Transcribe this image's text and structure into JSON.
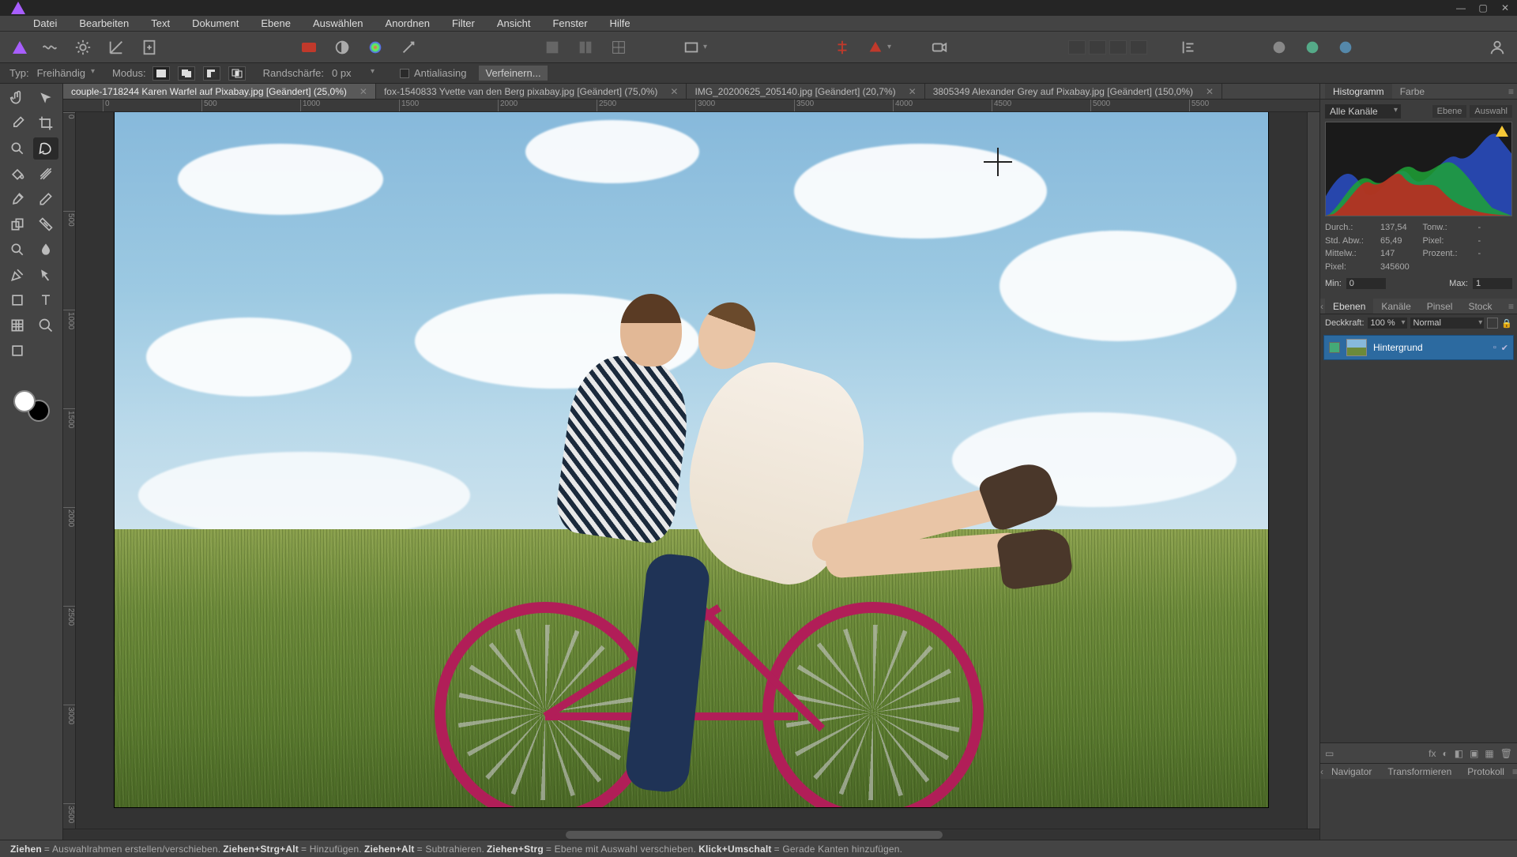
{
  "menus": [
    "Datei",
    "Bearbeiten",
    "Text",
    "Dokument",
    "Ebene",
    "Auswählen",
    "Anordnen",
    "Filter",
    "Ansicht",
    "Fenster",
    "Hilfe"
  ],
  "context": {
    "typ_label": "Typ:",
    "typ_value": "Freihändig",
    "modus_label": "Modus:",
    "feather_label": "Randschärfe:",
    "feather_value": "0 px",
    "antialias_label": "Antialiasing",
    "refine_label": "Verfeinern..."
  },
  "tabs": [
    {
      "title": "couple-1718244 Karen Warfel auf Pixabay.jpg [Geändert] (25,0%)",
      "active": true
    },
    {
      "title": "fox-1540833 Yvette van den Berg pixabay.jpg [Geändert] (75,0%)",
      "active": false
    },
    {
      "title": "IMG_20200625_205140.jpg [Geändert] (20,7%)",
      "active": false
    },
    {
      "title": "3805349 Alexander Grey auf Pixabay.jpg [Geändert] (150,0%)",
      "active": false
    }
  ],
  "ruler_h": [
    "0",
    "500",
    "1000",
    "1500",
    "2000",
    "2500",
    "3000",
    "3500",
    "4000",
    "4500",
    "5000",
    "5500"
  ],
  "ruler_v": [
    "0",
    "500",
    "1000",
    "1500",
    "2000",
    "2500",
    "3000",
    "3500"
  ],
  "hist_panel": {
    "tabs": [
      "Histogramm",
      "Farbe"
    ],
    "channel_label": "Alle Kanäle",
    "btn_layer": "Ebene",
    "btn_sel": "Auswahl",
    "stats": {
      "durch_l": "Durch.:",
      "durch_v": "137,54",
      "abw_l": "Std. Abw.:",
      "abw_v": "65,49",
      "mittel_l": "Mittelw.:",
      "mittel_v": "147",
      "pixel_l": "Pixel:",
      "pixel_v": "345600",
      "tonw_l": "Tonw.:",
      "tonw_v": "-",
      "pix2_l": "Pixel:",
      "pix2_v": "-",
      "proz_l": "Prozent.:",
      "proz_v": "-"
    },
    "min_l": "Min:",
    "min_v": "0",
    "max_l": "Max:",
    "max_v": "1"
  },
  "layers_panel": {
    "tabs": [
      "Ebenen",
      "Kanäle",
      "Pinsel",
      "Stock"
    ],
    "opacity_label": "Deckkraft:",
    "opacity_value": "100 %",
    "blend_value": "Normal",
    "layers": [
      {
        "name": "Hintergrund"
      }
    ],
    "bottom_tabs": [
      "Navigator",
      "Transformieren",
      "Protokoll"
    ]
  },
  "status": {
    "s1_b": "Ziehen",
    "s1_t": " = Auswahlrahmen erstellen/verschieben. ",
    "s2_b": "Ziehen+Strg+Alt",
    "s2_t": " = Hinzufügen. ",
    "s3_b": "Ziehen+Alt",
    "s3_t": " = Subtrahieren. ",
    "s4_b": "Ziehen+Strg",
    "s4_t": " = Ebene mit Auswahl verschieben. ",
    "s5_b": "Klick+Umschalt",
    "s5_t": " = Gerade Kanten hinzufügen."
  }
}
